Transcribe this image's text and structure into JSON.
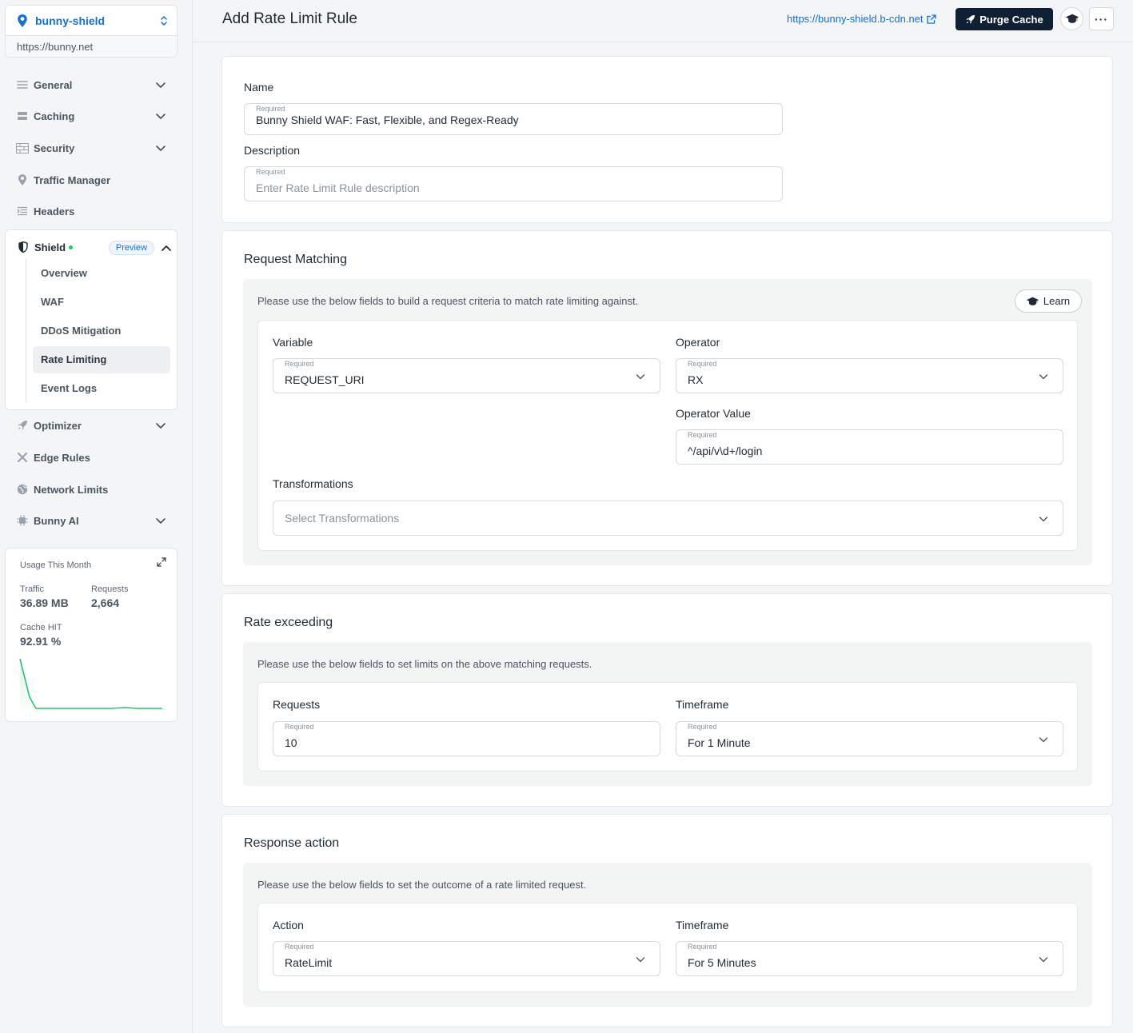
{
  "sidebar": {
    "zone_name": "bunny-shield",
    "zone_url": "https://bunny.net",
    "nav": {
      "general": "General",
      "caching": "Caching",
      "security": "Security",
      "traffic_manager": "Traffic Manager",
      "headers": "Headers",
      "optimizer": "Optimizer",
      "edge_rules": "Edge Rules",
      "network_limits": "Network Limits",
      "bunny_ai": "Bunny AI"
    },
    "shield": {
      "label": "Shield",
      "badge": "Preview",
      "items": [
        "Overview",
        "WAF",
        "DDoS Mitigation",
        "Rate Limiting",
        "Event Logs"
      ],
      "active": "Rate Limiting"
    },
    "usage": {
      "title": "Usage This Month",
      "traffic_label": "Traffic",
      "traffic_value": "36.89 MB",
      "requests_label": "Requests",
      "requests_value": "2,664",
      "cache_label": "Cache HIT",
      "cache_value": "92.91 %",
      "line_color": "#2fbf71"
    }
  },
  "header": {
    "title": "Add Rate Limit Rule",
    "link": "https://bunny-shield.b-cdn.net",
    "purge_label": "Purge Cache",
    "more_label": "···"
  },
  "required": "Required",
  "general": {
    "name_label": "Name",
    "name_value": "Bunny Shield WAF: Fast, Flexible, and Regex-Ready",
    "desc_label": "Description",
    "desc_placeholder": "Enter Rate Limit Rule description"
  },
  "request_matching": {
    "title": "Request Matching",
    "hint": "Please use the below fields to build a request criteria to match rate limiting against.",
    "learn_label": "Learn",
    "variable_label": "Variable",
    "variable_value": "REQUEST_URI",
    "operator_label": "Operator",
    "operator_value": "RX",
    "operator_value_label": "Operator Value",
    "operator_value_value": "^/api/v\\d+/login",
    "transform_label": "Transformations",
    "transform_placeholder": "Select Transformations"
  },
  "rate_exceeding": {
    "title": "Rate exceeding",
    "hint": "Please use the below fields to set limits on the above matching requests.",
    "requests_label": "Requests",
    "requests_value": "10",
    "timeframe_label": "Timeframe",
    "timeframe_value": "For 1 Minute"
  },
  "response_action": {
    "title": "Response action",
    "hint": "Please use the below fields to set the outcome of a rate limited request.",
    "action_label": "Action",
    "action_value": "RateLimit",
    "timeframe_label": "Timeframe",
    "timeframe_value": "For 5 Minutes"
  },
  "colors": {
    "brand": "#1870c9",
    "dark_button": "#0f2034",
    "status_dot": "#22c55e"
  }
}
